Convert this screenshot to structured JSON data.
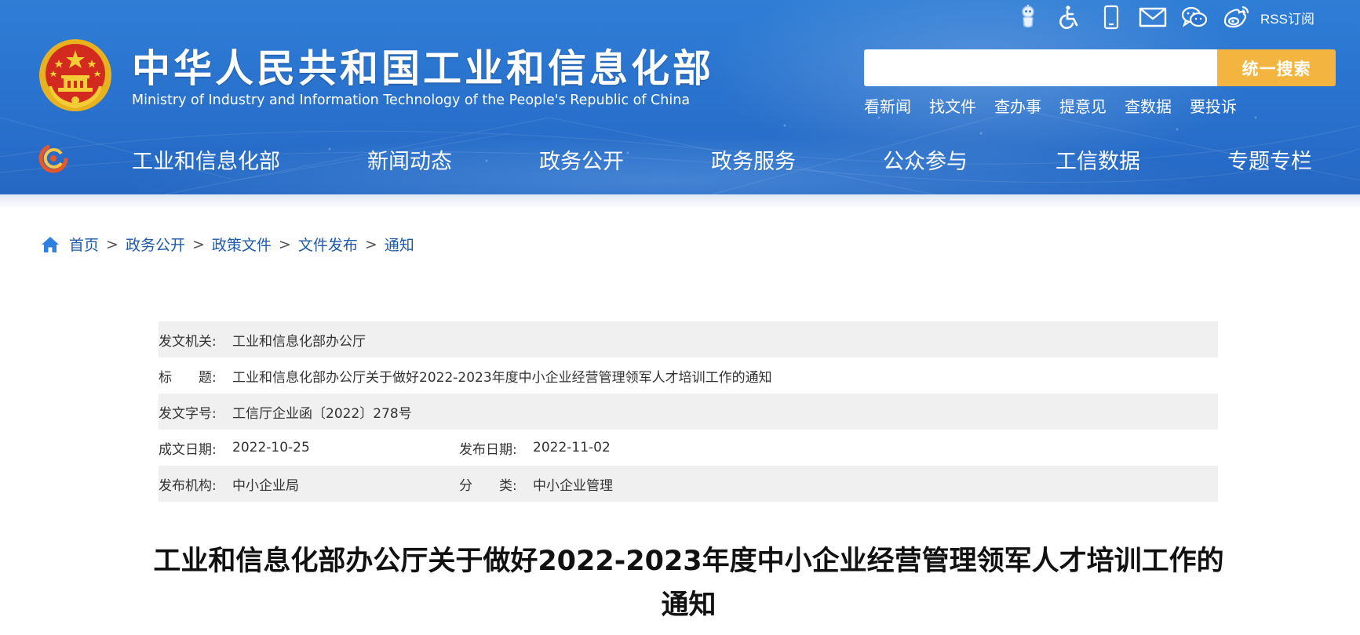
{
  "header": {
    "title": "中华人民共和国工业和信息化部",
    "subtitle": "Ministry of Industry and Information Technology of the People's Republic of China",
    "top_icons": [
      "robot-icon",
      "accessibility-icon",
      "mobile-icon",
      "mail-icon",
      "wechat-icon",
      "weibo-icon"
    ],
    "rss_label": "RSS订阅",
    "search": {
      "value": "",
      "placeholder": "",
      "button_label": "统一搜索",
      "button_color": "#f3b53f"
    },
    "quick_links": [
      "看新闻",
      "找文件",
      "查办事",
      "提意见",
      "查数据",
      "要投诉"
    ]
  },
  "nav": {
    "items": [
      "工业和信息化部",
      "新闻动态",
      "政务公开",
      "政务服务",
      "公众参与",
      "工信数据",
      "专题专栏"
    ]
  },
  "breadcrumb": {
    "items": [
      "首页",
      "政务公开",
      "政策文件",
      "文件发布",
      "通知"
    ],
    "separator": ">"
  },
  "info": {
    "issuer_label": "发文机关:",
    "issuer": "工业和信息化部办公厅",
    "title_label": "标　　题:",
    "title": "工业和信息化部办公厅关于做好2022-2023年度中小企业经营管理领军人才培训工作的通知",
    "docno_label": "发文字号:",
    "docno": "工信厅企业函〔2022〕278号",
    "created_label": "成文日期:",
    "created": "2022-10-25",
    "published_label": "发布日期:",
    "published": "2022-11-02",
    "agency_label": "发布机构:",
    "agency": "中小企业局",
    "category_label": "分　　类:",
    "category": "中小企业管理"
  },
  "article": {
    "title": "工业和信息化部办公厅关于做好2022-2023年度中小企业经营管理领军人才培训工作的通知"
  },
  "colors": {
    "header_blue": "#2a74cf",
    "link_blue": "#1e5aa8",
    "row_gray": "#f0f0f0"
  }
}
